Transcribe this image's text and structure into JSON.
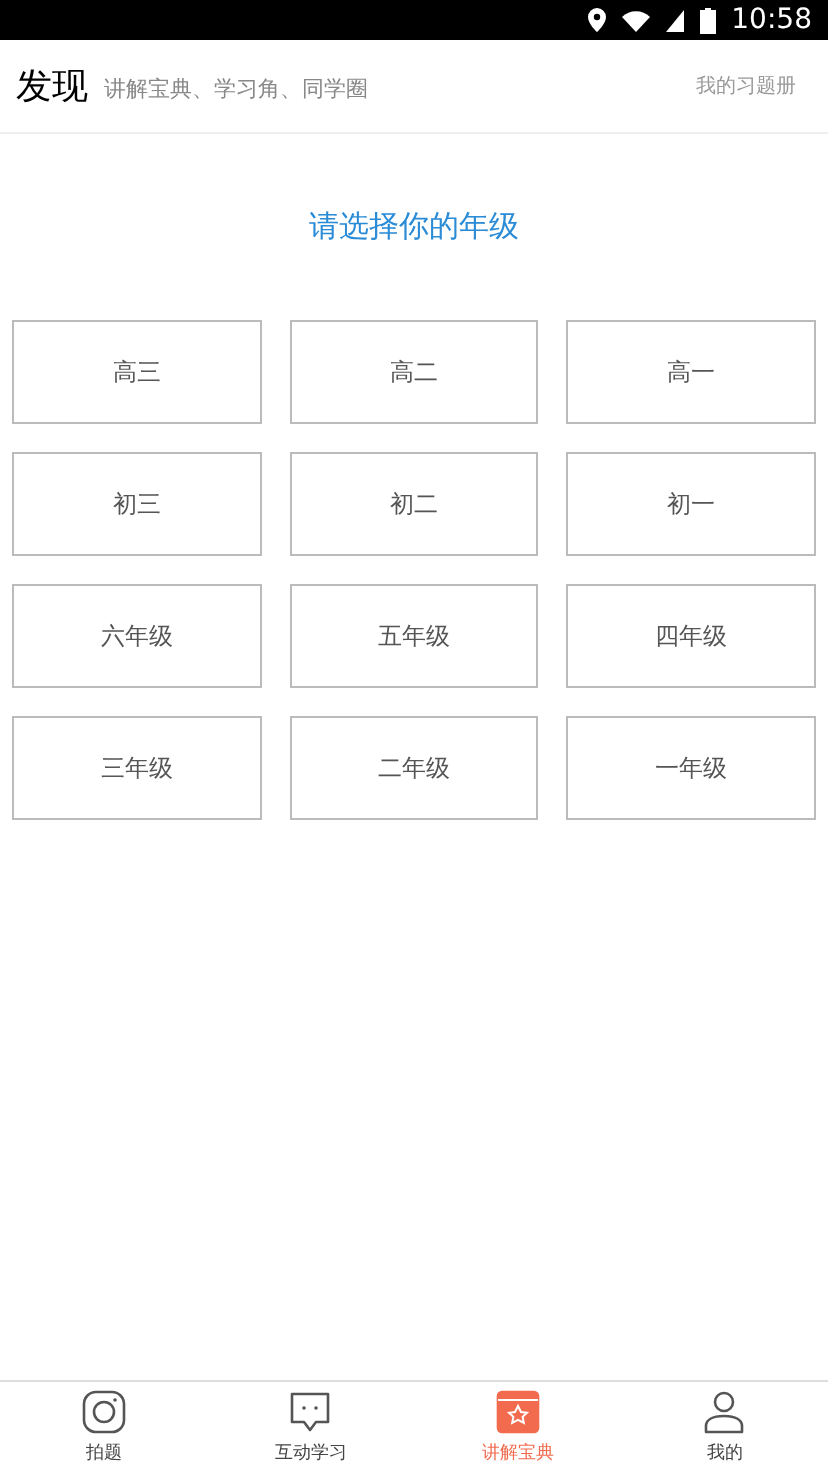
{
  "status_bar": {
    "time": "10:58"
  },
  "header": {
    "title": "发现",
    "subtitle": "讲解宝典、学习角、同学圈",
    "link": "我的习题册"
  },
  "prompt": "请选择你的年级",
  "grades": [
    {
      "label": "高三"
    },
    {
      "label": "高二"
    },
    {
      "label": "高一"
    },
    {
      "label": "初三"
    },
    {
      "label": "初二"
    },
    {
      "label": "初一"
    },
    {
      "label": "六年级"
    },
    {
      "label": "五年级"
    },
    {
      "label": "四年级"
    },
    {
      "label": "三年级"
    },
    {
      "label": "二年级"
    },
    {
      "label": "一年级"
    }
  ],
  "tabs": [
    {
      "label": "拍题",
      "kind": "camera",
      "selected": false
    },
    {
      "label": "互动学习",
      "kind": "chat",
      "selected": false
    },
    {
      "label": "讲解宝典",
      "kind": "book",
      "selected": true
    },
    {
      "label": "我的",
      "kind": "person",
      "selected": false
    }
  ]
}
